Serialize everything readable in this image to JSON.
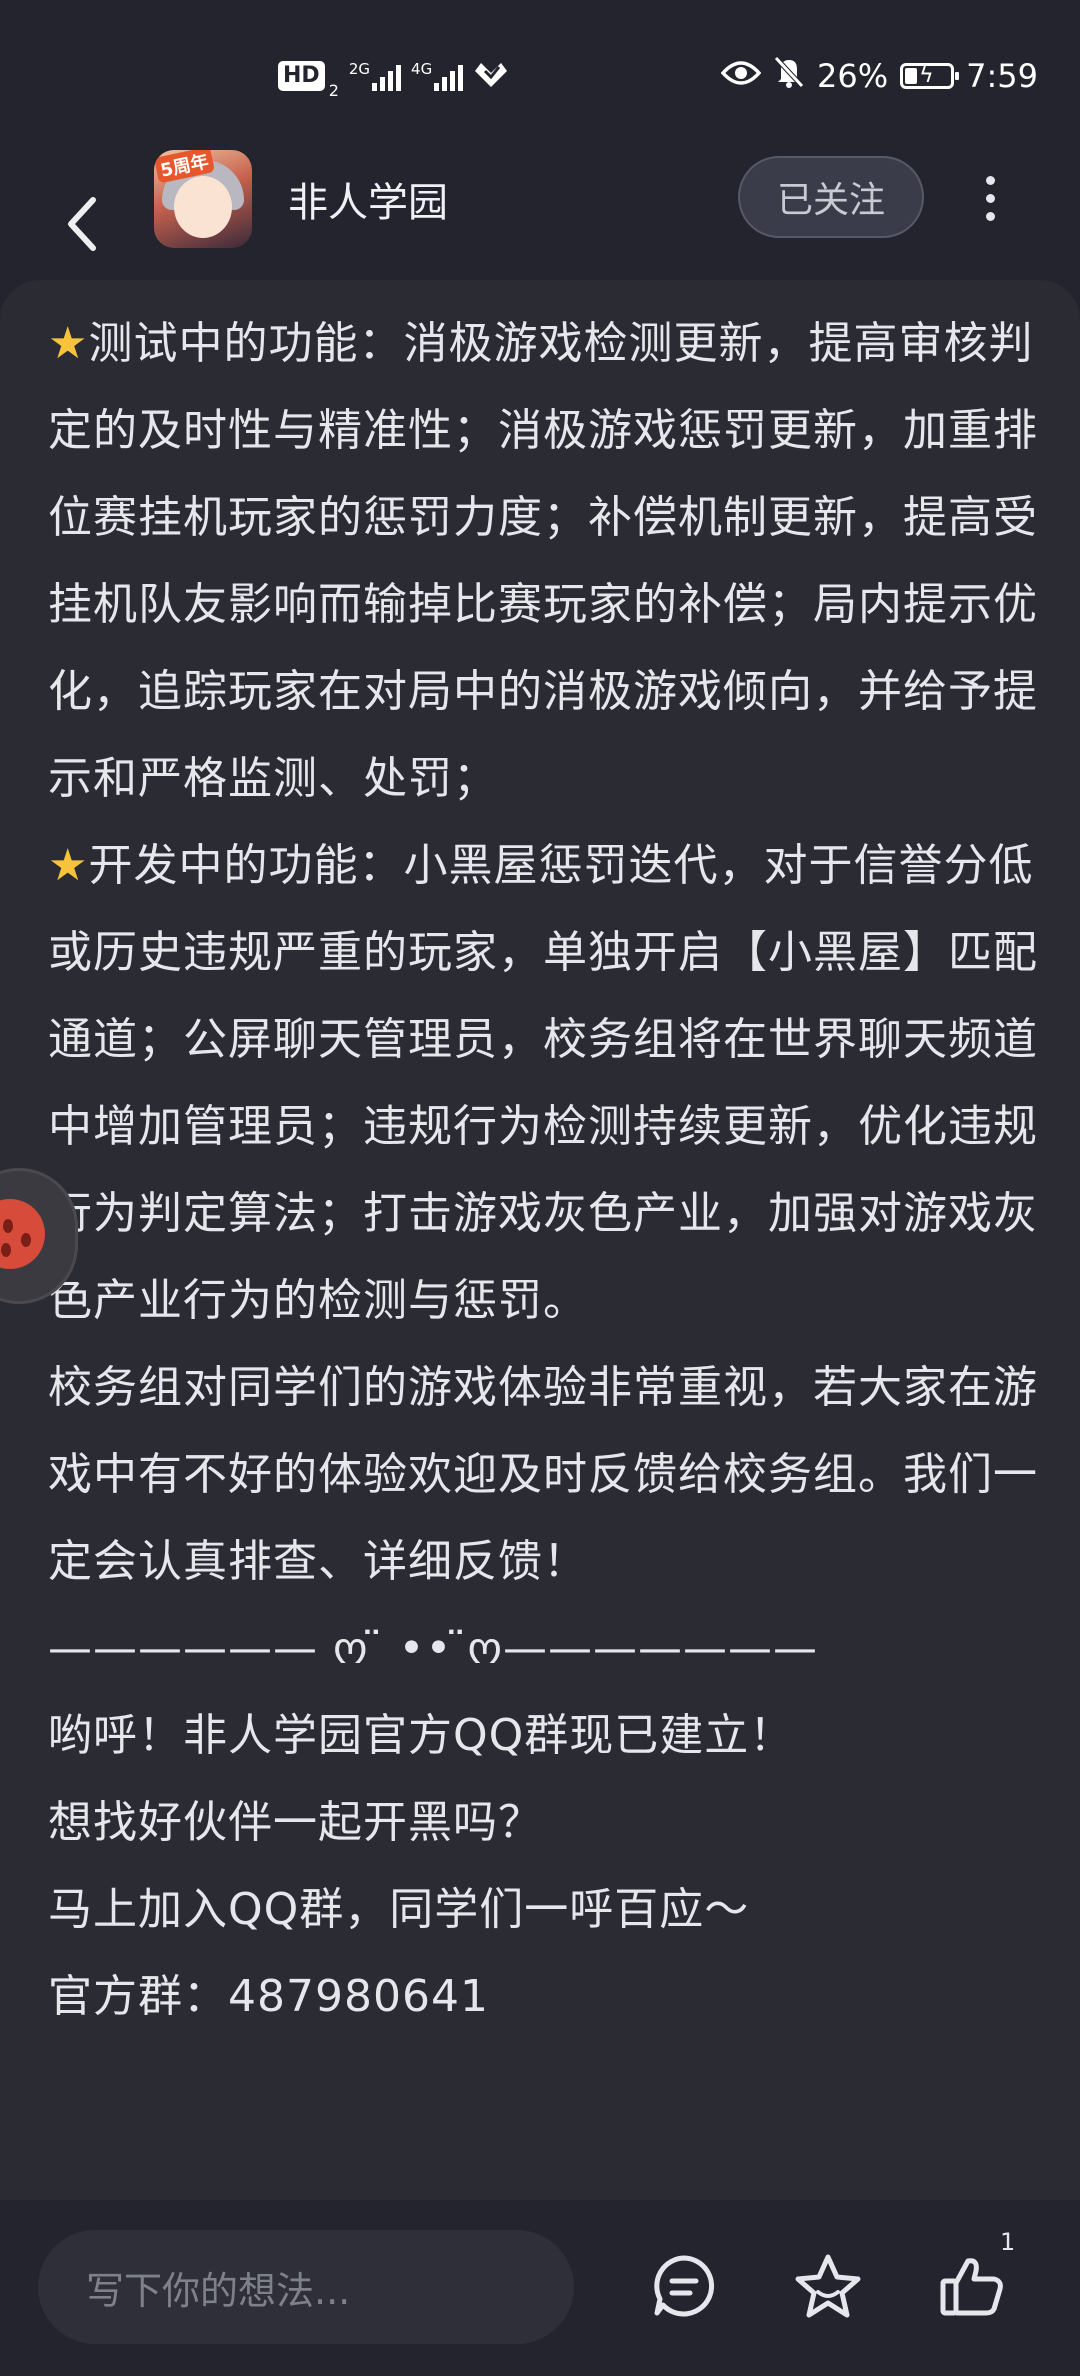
{
  "status_bar": {
    "hd": "HD",
    "hd_sub": "2",
    "sim1_label": "2G",
    "sim2_label": "4G",
    "battery": "26%",
    "battery_level": 0.26,
    "time": "7:59",
    "icons": [
      "eye-icon",
      "mute-bell-icon",
      "wifi-heart-icon"
    ]
  },
  "header": {
    "account_name": "非人学园",
    "avatar_badge": "5周年",
    "follow_label": "已关注"
  },
  "content": {
    "paragraphs": [
      "⭐测试中的功能：消极游戏检测更新，提高审核判定的及时性与精准性；消极游戏惩罚更新，加重排位赛挂机玩家的惩罚力度；补偿机制更新，提高受挂机队友影响而输掉比赛玩家的补偿；局内提示优化，追踪玩家在对局中的消极游戏倾向，并给予提示和严格监测、处罚；",
      "⭐开发中的功能：小黑屋惩罚迭代，对于信誉分低或历史违规严重的玩家，单独开启【小黑屋】匹配通道；公屏聊天管理员，校务组将在世界聊天频道中增加管理员；违规行为检测持续更新，优化违规行为判定算法；打击游戏灰色产业，加强对游戏灰色产业行为的检测与惩罚。",
      "校务组对同学们的游戏体验非常重视，若大家在游戏中有不好的体验欢迎及时反馈给校务组。我们一定会认真排查、详细反馈！",
      "——————  ო ̈ •• ̈ო———————",
      "哟呼！非人学园官方QQ群现已建立！",
      "想找好伙伴一起开黑吗？",
      "马上加入QQ群，同学们一呼百应～",
      "官方群：487980641"
    ]
  },
  "bottom_bar": {
    "comment_placeholder": "写下你的想法...",
    "like_count": "1",
    "icons": [
      "comment-icon",
      "star-icon",
      "thumbs-up-icon"
    ]
  }
}
